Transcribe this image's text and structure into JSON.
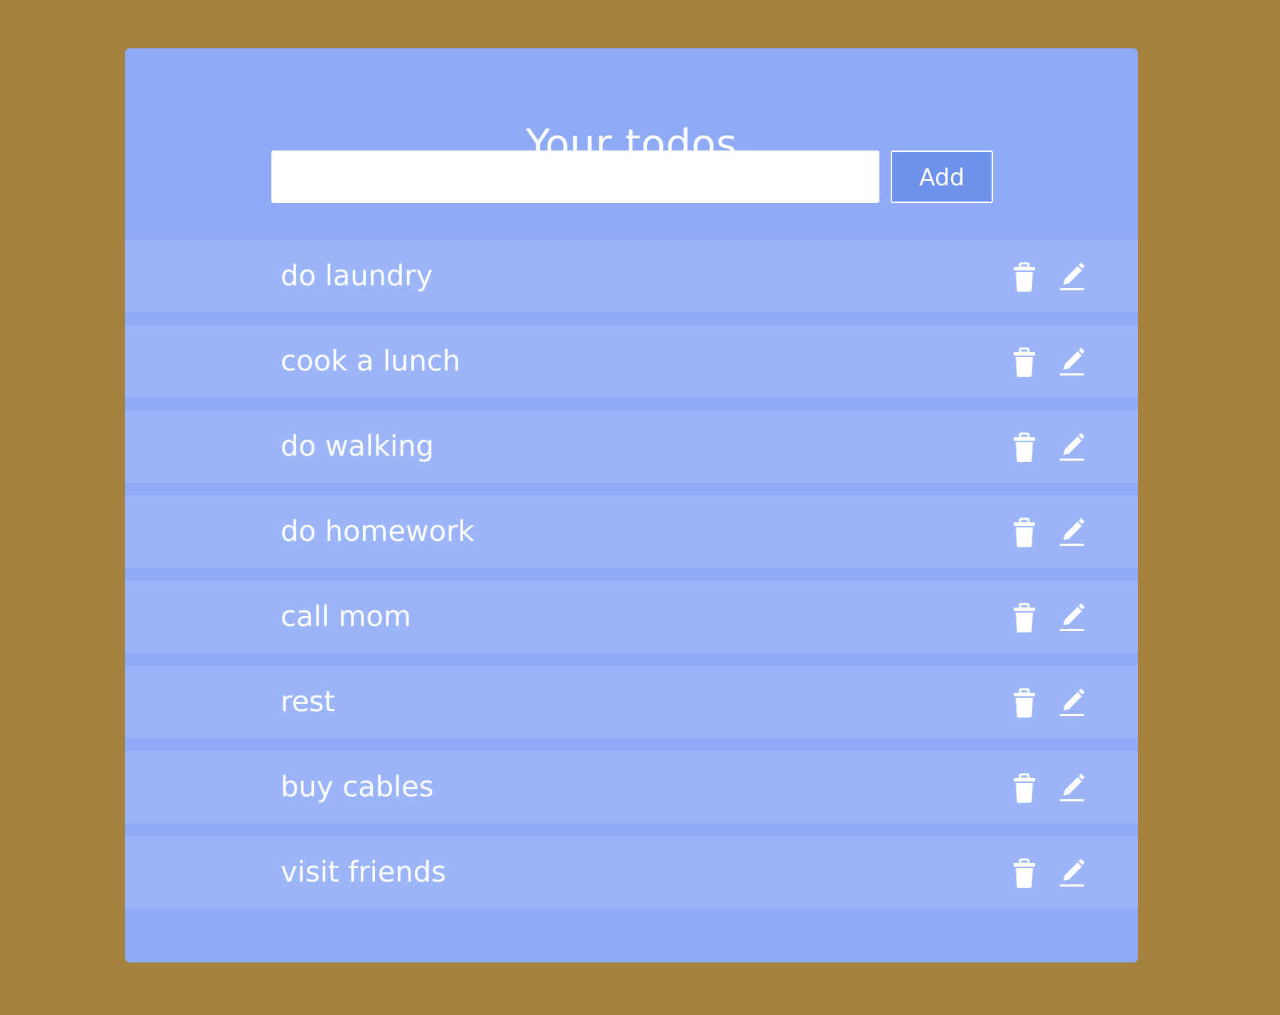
{
  "app": {
    "title": "Your todos"
  },
  "form": {
    "input_value": "",
    "input_placeholder": "",
    "add_label": "Add"
  },
  "todos": [
    {
      "text": "do laundry"
    },
    {
      "text": "cook a lunch"
    },
    {
      "text": "do walking"
    },
    {
      "text": "do homework"
    },
    {
      "text": "call mom"
    },
    {
      "text": "rest"
    },
    {
      "text": "buy cables"
    },
    {
      "text": "visit friends"
    }
  ],
  "icons": {
    "delete": "trash-icon",
    "edit": "pencil-icon"
  },
  "colors": {
    "page_background": "#a3833d",
    "card_background": "#8fabf6",
    "row_background": "#9bb5f8",
    "add_button_background": "#6e92ec",
    "text": "#ffffff"
  }
}
